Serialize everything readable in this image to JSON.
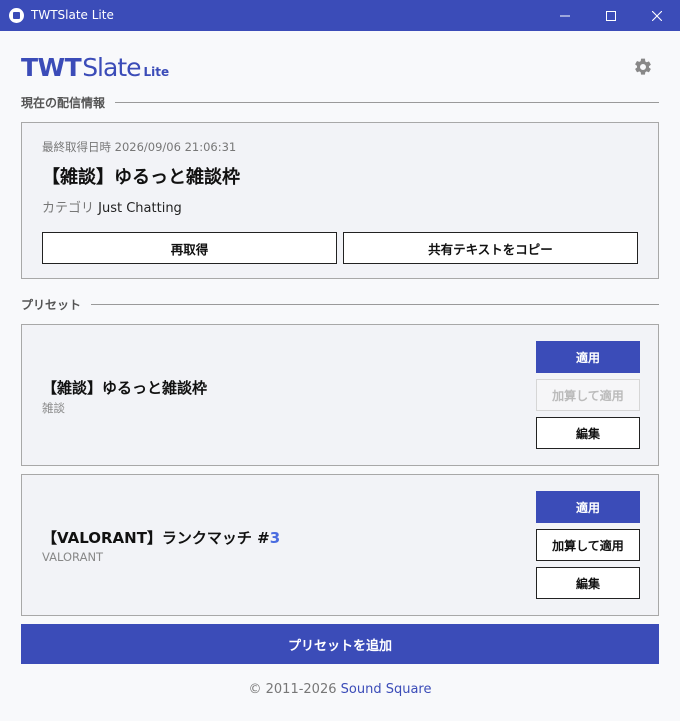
{
  "window": {
    "title": "TWTSlate Lite",
    "controls": [
      "minimize-icon",
      "maximize-icon",
      "close-icon"
    ]
  },
  "header": {
    "logo_bold": "TWT",
    "logo_thin": "Slate",
    "logo_suffix": "Lite",
    "settings_icon": "gear-icon"
  },
  "current": {
    "section_label": "現在の配信情報",
    "last_fetched_label": "最終取得日時",
    "last_fetched_value": "2026/09/06 21:06:31",
    "title": "【雑談】ゆるっと雑談枠",
    "category_label": "カテゴリ",
    "category_value": "Just Chatting",
    "refetch_label": "再取得",
    "copy_label": "共有テキストをコピー"
  },
  "presets": {
    "section_label": "プリセット",
    "items": [
      {
        "name": "【雑談】ゆるっと雑談枠",
        "name_suffix": "",
        "category": "雑談",
        "apply_label": "適用",
        "add_apply_label": "加算して適用",
        "add_apply_disabled": true,
        "edit_label": "編集"
      },
      {
        "name": "【VALORANT】ランクマッチ #",
        "name_suffix": "3",
        "category": "VALORANT",
        "apply_label": "適用",
        "add_apply_label": "加算して適用",
        "add_apply_disabled": false,
        "edit_label": "編集"
      }
    ],
    "add_label": "プリセットを追加"
  },
  "footer": {
    "copyright": "© 2011-2026",
    "link": "Sound Square"
  },
  "colors": {
    "accent": "#3b4cb8",
    "number_highlight": "#4a6ce0"
  }
}
